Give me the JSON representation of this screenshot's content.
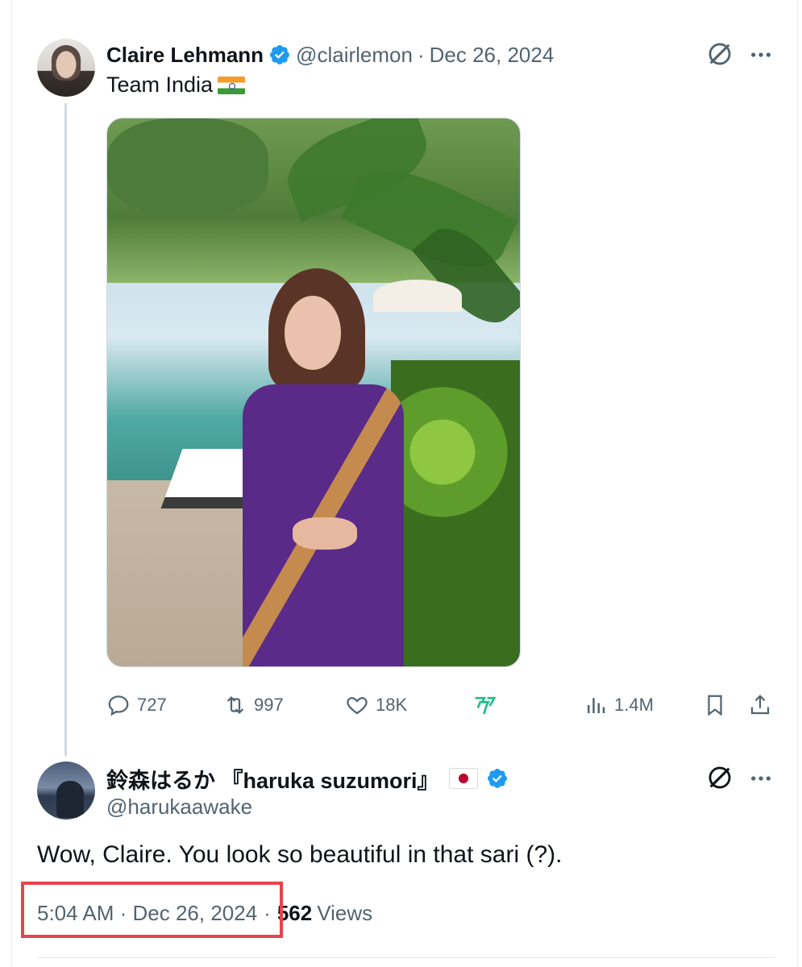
{
  "tweet1": {
    "name": "Claire Lehmann",
    "handle": "@clairlemon",
    "separator": "·",
    "date": "Dec 26, 2024",
    "text": "Team India",
    "flag": "india-flag",
    "image_description": "photo",
    "actions": {
      "reply_count": "727",
      "retweet_count": "997",
      "like_count": "18K",
      "views_count": "1.4M"
    }
  },
  "tweet2": {
    "name": "鈴森はるか 『haruka suzumori』",
    "flag": "japan-flag",
    "handle": "@harukaawake",
    "text": "Wow, Claire. You look so beautiful in that sari (?).",
    "timestamp": "5:04 AM · Dec 26, 2024",
    "meta_separator": "·",
    "views_count": "562",
    "views_label": "Views"
  },
  "colors": {
    "verified": "#1d9bf0",
    "secondary_text": "#536471",
    "primary_text": "#0f1419",
    "highlight_box": "#e8434d",
    "grok_green": "#1fbf8f"
  },
  "icons": [
    "verified-badge-icon",
    "grok-icon",
    "more-icon",
    "reply-icon",
    "retweet-icon",
    "like-icon",
    "grok-icon",
    "views-icon",
    "bookmark-icon",
    "share-icon"
  ]
}
